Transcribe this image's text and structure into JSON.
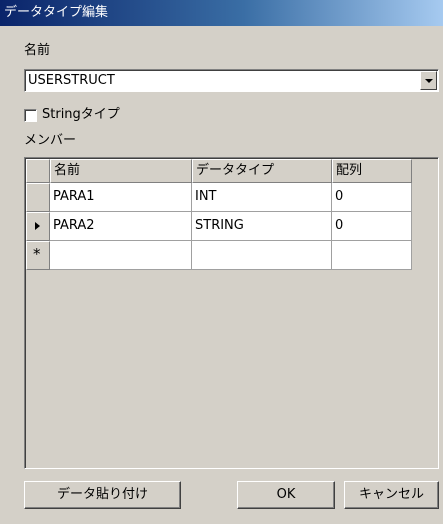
{
  "window": {
    "title": "データタイプ編集"
  },
  "name_label": "名前",
  "struct_combo": {
    "value": "USERSTRUCT"
  },
  "string_type": {
    "label": "Stringタイプ",
    "checked": false
  },
  "members_label": "メンバー",
  "members_table": {
    "headers": [
      "名前",
      "データタイプ",
      "配列"
    ],
    "rows": [
      {
        "name": "PARA1",
        "type": "INT",
        "array": "0",
        "indicator": ""
      },
      {
        "name": "PARA2",
        "type": "STRING",
        "array": "0",
        "indicator": "current-row-arrow"
      }
    ],
    "new_row_indicator": "*"
  },
  "buttons": {
    "paste_data": "データ貼り付け",
    "ok": "OK",
    "cancel": "キャンセル"
  },
  "colors": {
    "title_gradient_start": "#0a246a",
    "title_gradient_end": "#a6caf0",
    "face": "#d4d0c8"
  }
}
